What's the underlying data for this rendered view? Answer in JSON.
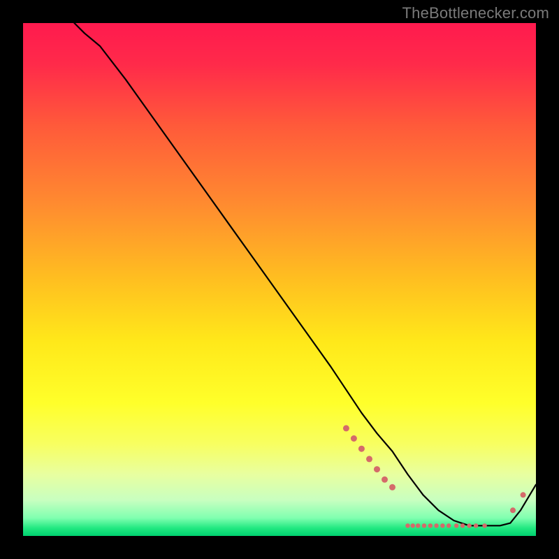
{
  "watermark": "TheBottlenecker.com",
  "colors": {
    "gradient_stops": [
      {
        "offset": 0.0,
        "color": "#ff1a4e"
      },
      {
        "offset": 0.08,
        "color": "#ff2a4a"
      },
      {
        "offset": 0.2,
        "color": "#ff5a3a"
      },
      {
        "offset": 0.35,
        "color": "#ff8a30"
      },
      {
        "offset": 0.5,
        "color": "#ffbf20"
      },
      {
        "offset": 0.62,
        "color": "#ffe81a"
      },
      {
        "offset": 0.74,
        "color": "#ffff2a"
      },
      {
        "offset": 0.82,
        "color": "#f8ff60"
      },
      {
        "offset": 0.88,
        "color": "#e8ffa0"
      },
      {
        "offset": 0.93,
        "color": "#c8ffc0"
      },
      {
        "offset": 0.965,
        "color": "#80ffb0"
      },
      {
        "offset": 0.985,
        "color": "#20e880"
      },
      {
        "offset": 1.0,
        "color": "#00d070"
      }
    ],
    "line": "#000000",
    "marker": "#d46a6a"
  },
  "chart_data": {
    "type": "line",
    "title": "",
    "xlabel": "",
    "ylabel": "",
    "xlim": [
      0,
      100
    ],
    "ylim": [
      0,
      100
    ],
    "series": [
      {
        "name": "curve",
        "x": [
          10,
          12,
          15,
          20,
          25,
          30,
          35,
          40,
          45,
          50,
          55,
          60,
          63,
          66,
          69,
          72,
          75,
          78,
          81,
          84,
          87,
          90,
          93,
          95,
          97,
          100
        ],
        "y": [
          100,
          98,
          95.5,
          89,
          82,
          75,
          68,
          61,
          54,
          47,
          40,
          33,
          28.5,
          24,
          20,
          16.5,
          12,
          8,
          5,
          3,
          2,
          2,
          2,
          2.5,
          5,
          10
        ]
      }
    ],
    "markers": [
      {
        "x": 63,
        "y": 21,
        "r": 4.5
      },
      {
        "x": 64.5,
        "y": 19,
        "r": 4.5
      },
      {
        "x": 66,
        "y": 17,
        "r": 4.5
      },
      {
        "x": 67.5,
        "y": 15,
        "r": 4.5
      },
      {
        "x": 69,
        "y": 13,
        "r": 4.5
      },
      {
        "x": 70.5,
        "y": 11,
        "r": 4.5
      },
      {
        "x": 72,
        "y": 9.5,
        "r": 4.5
      },
      {
        "x": 75,
        "y": 2,
        "r": 3.2
      },
      {
        "x": 76,
        "y": 2,
        "r": 3.2
      },
      {
        "x": 77,
        "y": 2,
        "r": 3.2
      },
      {
        "x": 78.2,
        "y": 2,
        "r": 3.2
      },
      {
        "x": 79.4,
        "y": 2,
        "r": 3.2
      },
      {
        "x": 80.6,
        "y": 2,
        "r": 3.2
      },
      {
        "x": 81.8,
        "y": 2,
        "r": 3.2
      },
      {
        "x": 83,
        "y": 2,
        "r": 3.2
      },
      {
        "x": 84.5,
        "y": 2,
        "r": 3.2
      },
      {
        "x": 85.7,
        "y": 2,
        "r": 3.2
      },
      {
        "x": 87,
        "y": 2,
        "r": 3.2
      },
      {
        "x": 88.3,
        "y": 2,
        "r": 3.2
      },
      {
        "x": 90,
        "y": 2,
        "r": 3.2
      },
      {
        "x": 95.5,
        "y": 5,
        "r": 4
      },
      {
        "x": 97.5,
        "y": 8,
        "r": 4
      }
    ]
  }
}
